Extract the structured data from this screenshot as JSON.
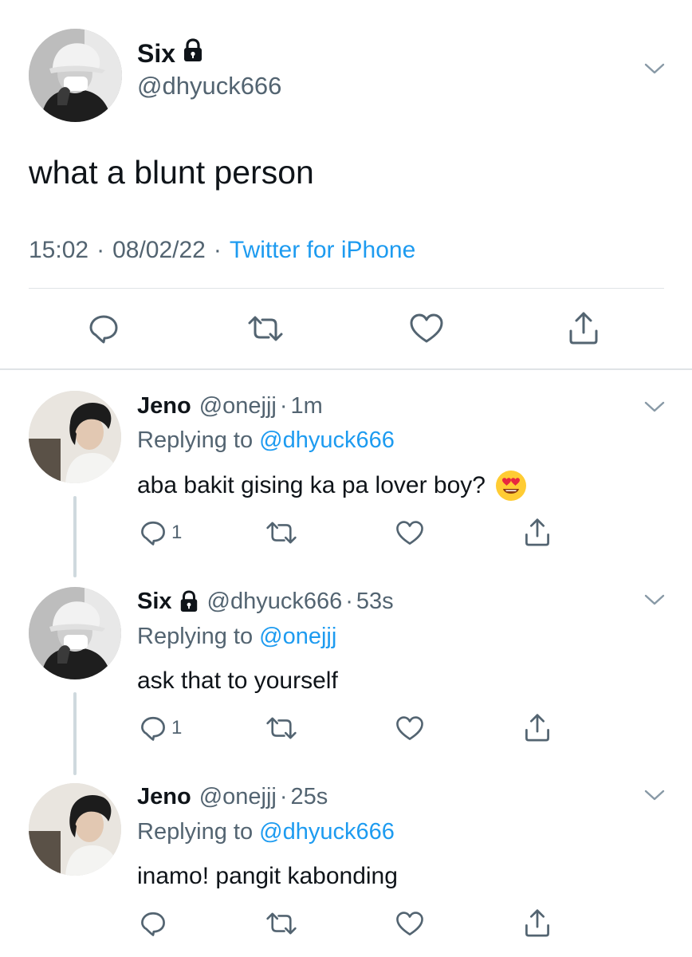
{
  "main_tweet": {
    "author_name": "Six",
    "handle": "@dhyuck666",
    "text": "what a blunt person",
    "time": "15:02",
    "date": "08/02/22",
    "source": "Twitter for iPhone",
    "separator": "·",
    "icons": [
      "lock-icon",
      "chevron-down-icon",
      "reply-icon",
      "retweet-icon",
      "like-icon",
      "share-icon"
    ]
  },
  "replies": [
    {
      "name": "Jeno",
      "handle": "@onejjj",
      "dot": "·",
      "time": "1m",
      "replying_prefix": "Replying to ",
      "replying_to": "@dhyuck666",
      "text": "aba bakit gising ka pa lover boy?",
      "emoji": "smiling-face-with-heart-eyes",
      "reply_count": "1",
      "locked": false
    },
    {
      "name": "Six",
      "handle": "@dhyuck666",
      "dot": "·",
      "time": "53s",
      "replying_prefix": "Replying to ",
      "replying_to": "@onejjj",
      "text": "ask that to yourself",
      "reply_count": "1",
      "locked": true
    },
    {
      "name": "Jeno",
      "handle": "@onejjj",
      "dot": "·",
      "time": "25s",
      "replying_prefix": "Replying to ",
      "replying_to": "@dhyuck666",
      "text": "inamo! pangit kabonding",
      "reply_count": "",
      "locked": false
    }
  ],
  "colors": {
    "link": "#1d9bf0",
    "secondary_text": "#536471",
    "primary_text": "#0f1419",
    "divider": "#dfe3e6",
    "thread_line": "#cfd9de"
  }
}
